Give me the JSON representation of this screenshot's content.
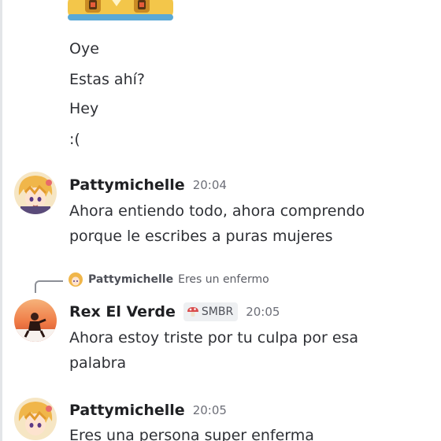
{
  "earlier_lines": [
    "Oye",
    "Estas ahí?",
    "Hey",
    ":("
  ],
  "messages": [
    {
      "username": "Pattymichelle",
      "time": "20:04",
      "lines": [
        "Ahora entiendo todo, ahora comprendo",
        "porque le escribes a puras mujeres"
      ]
    },
    {
      "username": "Rex El Verde",
      "role_tag": "SMBR",
      "time": "20:05",
      "reply": {
        "username": "Pattymichelle",
        "text": "Eres un enfermo"
      },
      "lines": [
        "Ahora estoy triste por tu culpa por esa",
        "palabra"
      ]
    },
    {
      "username": "Pattymichelle",
      "time": "20:05",
      "lines": [
        "Eres una persona super enferma"
      ]
    }
  ],
  "colors": {
    "username": "#1f2023",
    "timestamp": "#6d6f78",
    "text": "#2e3035",
    "sticker_gold": "#f3c64a",
    "sticker_blue": "#5aa9d6"
  },
  "icons": {
    "avatar_patty": "anime-girl-avatar",
    "avatar_rex": "sunset-figure-avatar",
    "role_icon": "mushroom-icon",
    "sticker": "sticker-image"
  }
}
